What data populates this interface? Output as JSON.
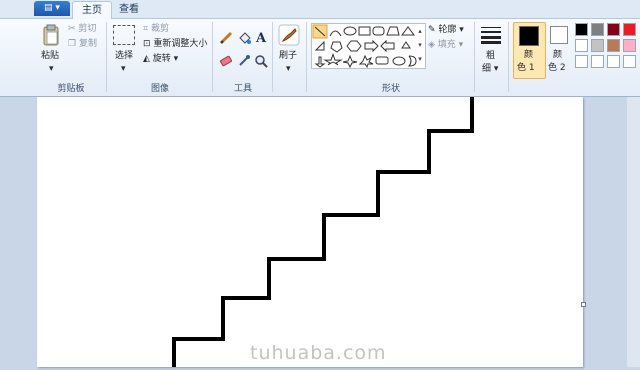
{
  "tabs": {
    "file_icon": "▤ ▾",
    "home": "主页",
    "view": "查看"
  },
  "clipboard": {
    "paste": "粘贴",
    "cut": "剪切",
    "copy": "复制",
    "group": "剪贴板"
  },
  "image": {
    "select": "选择",
    "crop": "裁剪",
    "resize": "重新调整大小",
    "rotate": "旋转",
    "group": "图像"
  },
  "tools": {
    "group": "工具",
    "text_glyph": "A"
  },
  "brushes": {
    "label": "刷子"
  },
  "shapes": {
    "outline": "轮廓",
    "fill": "填充",
    "group": "形状"
  },
  "size": {
    "label_line1": "粗",
    "label_line2": "细"
  },
  "colors": {
    "color1_line1": "颜",
    "color1_line2": "色 1",
    "color2_line1": "颜",
    "color2_line2": "色 2",
    "color1_value": "#000000",
    "color2_value": "#ffffff",
    "palette": [
      "#000000",
      "#7f7f7f",
      "#880015",
      "#ed1c24",
      "#ffffff",
      "#c3c3c3",
      "#b97a57",
      "#ffaec9",
      "#ffffff",
      "#ffffff",
      "#ffffff",
      "#ffffff"
    ]
  },
  "canvas": {
    "stroke_color": "#000000"
  },
  "watermark": "tuhuaba.com"
}
